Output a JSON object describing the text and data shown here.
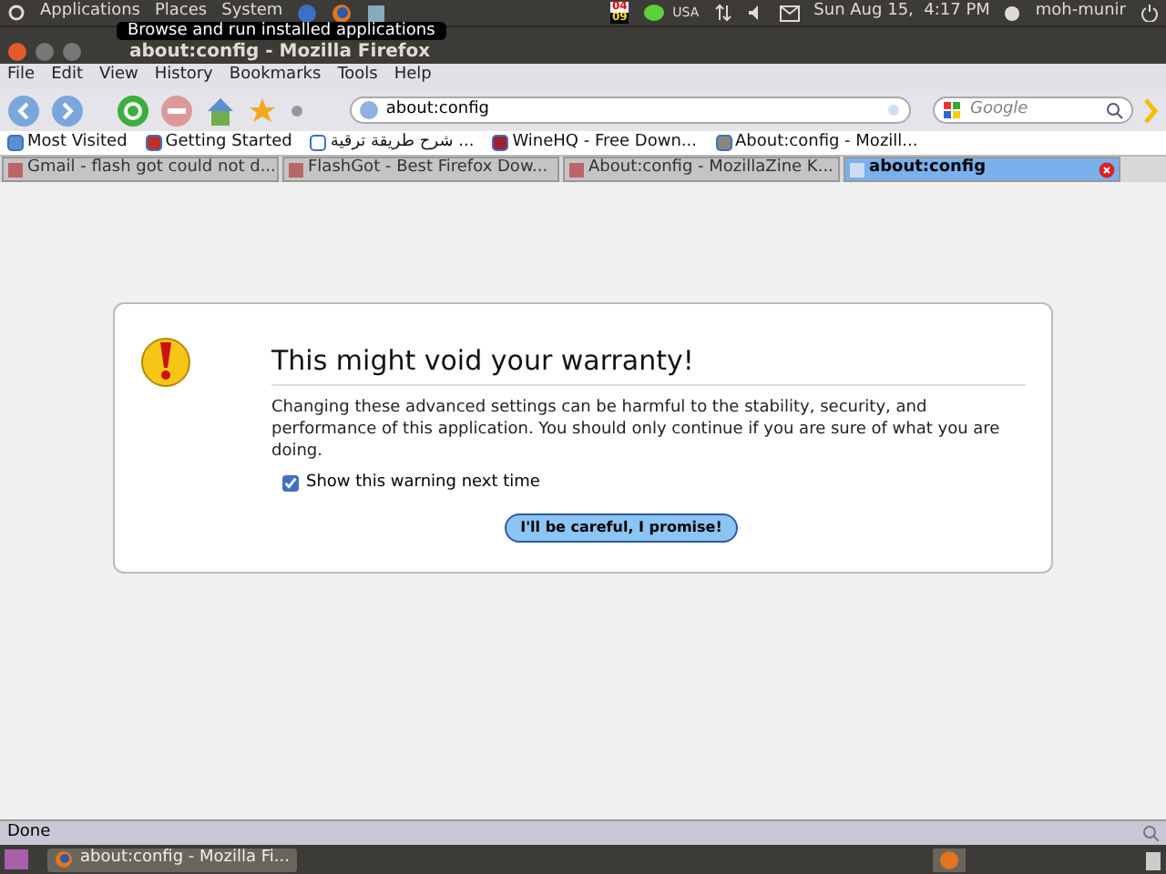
{
  "top_panel": {
    "menus": [
      "Applications",
      "Places",
      "System"
    ],
    "calendar": [
      "04",
      "09"
    ],
    "keyboard": "USA",
    "clock": "Sun Aug 15,  4:17 PM",
    "user": "moh-munir"
  },
  "tooltip": "Browse and run installed applications",
  "window": {
    "title": "about:config - Mozilla Firefox"
  },
  "menu_bar": [
    "File",
    "Edit",
    "View",
    "History",
    "Bookmarks",
    "Tools",
    "Help"
  ],
  "toolbar": {
    "url": "about:config",
    "search_placeholder": "Google"
  },
  "bookmarks": [
    "Most Visited",
    "Getting Started",
    "شرح طريقة ترقية ...",
    "WineHQ - Free Down...",
    "About:config - Mozill..."
  ],
  "tabs": [
    {
      "label": "Gmail - flash got could not d...",
      "selected": false
    },
    {
      "label": "FlashGot - Best Firefox Dow...",
      "selected": false
    },
    {
      "label": "About:config - MozillaZine K...",
      "selected": false
    },
    {
      "label": "about:config",
      "selected": true
    }
  ],
  "warning": {
    "title": "This might void your warranty!",
    "text": "Changing these advanced settings can be harmful to the stability, security, and performance of this application. You should only continue if you are sure of what you are doing.",
    "checkbox": {
      "label": "Show this warning next time",
      "checked": true
    },
    "button": "I'll be careful, I promise!"
  },
  "status_bar": "Done",
  "taskbar": {
    "window": "about:config - Mozilla Fi..."
  }
}
